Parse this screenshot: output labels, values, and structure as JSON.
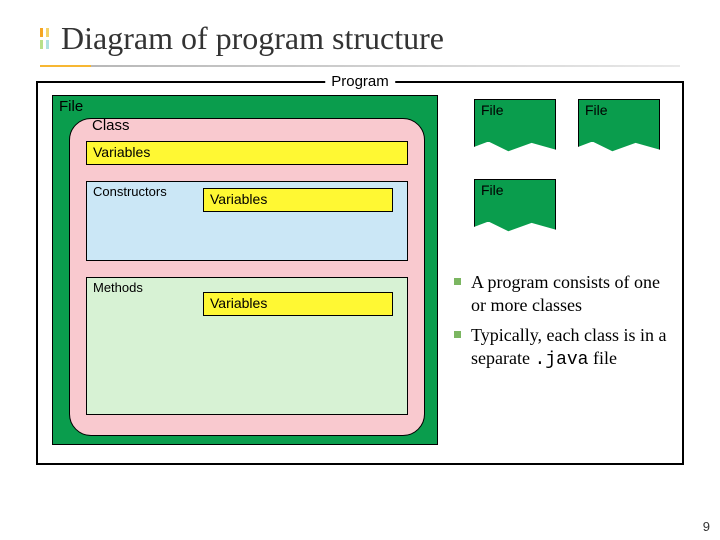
{
  "title": "Diagram of program structure",
  "program_label": "Program",
  "file_label": "File",
  "class_label": "Class",
  "variables_label": "Variables",
  "constructors_label": "Constructors",
  "methods_label": "Methods",
  "file_tabs": [
    "File",
    "File",
    "File"
  ],
  "bullets": [
    {
      "pre": "A program consists of one or more classes",
      "code": ""
    },
    {
      "pre": "Typically, each class is in a separate ",
      "code": ".java",
      "post": " file"
    }
  ],
  "page_number": "9",
  "accent": {
    "c1": "#f6a623",
    "c2": "#f3d36b",
    "c3": "#b8e08a",
    "c4": "#aee1e1"
  }
}
